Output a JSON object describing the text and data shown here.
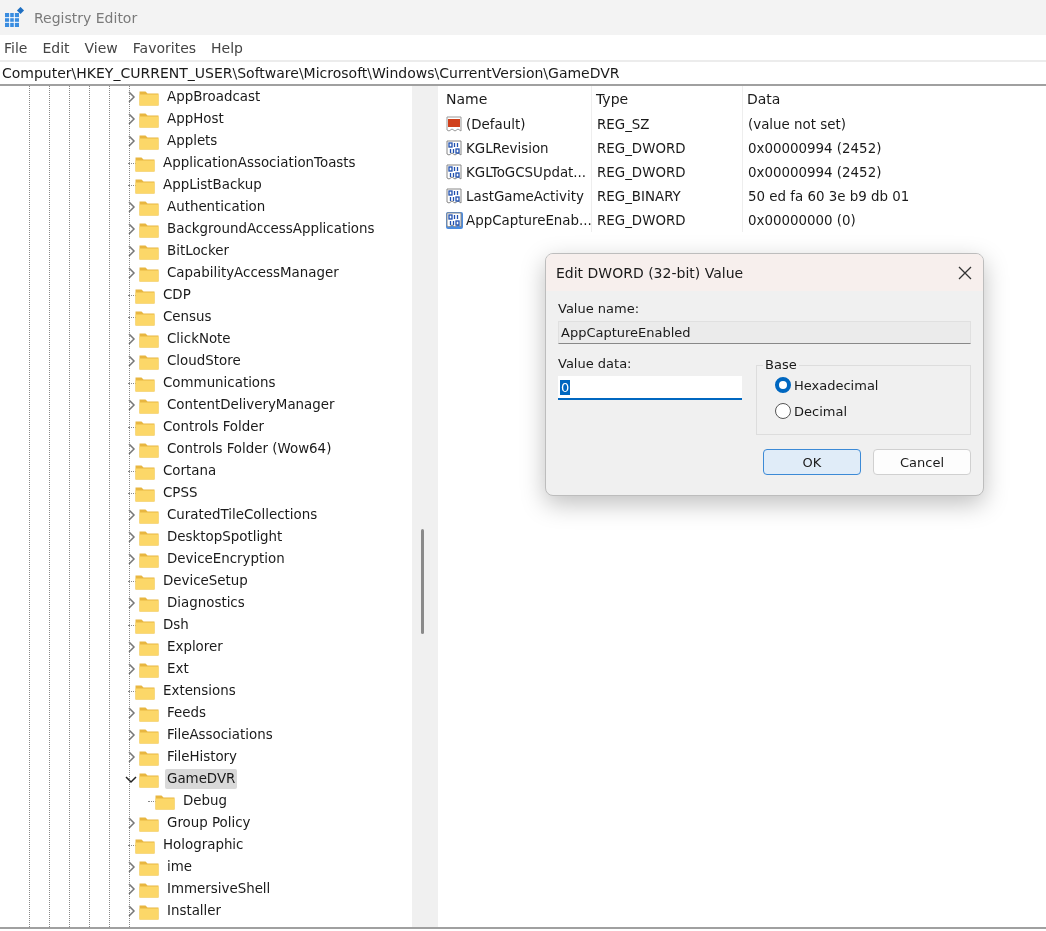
{
  "window": {
    "title": "Registry Editor"
  },
  "menu": [
    "File",
    "Edit",
    "View",
    "Favorites",
    "Help"
  ],
  "address": "Computer\\HKEY_CURRENT_USER\\Software\\Microsoft\\Windows\\CurrentVersion\\GameDVR",
  "tree": [
    {
      "label": "AppBroadcast",
      "expandable": true,
      "expanded": false,
      "selected": false
    },
    {
      "label": "AppHost",
      "expandable": true,
      "expanded": false,
      "selected": false
    },
    {
      "label": "Applets",
      "expandable": true,
      "expanded": false,
      "selected": false
    },
    {
      "label": "ApplicationAssociationToasts",
      "expandable": false,
      "expanded": false,
      "selected": false
    },
    {
      "label": "AppListBackup",
      "expandable": false,
      "expanded": false,
      "selected": false
    },
    {
      "label": "Authentication",
      "expandable": true,
      "expanded": false,
      "selected": false
    },
    {
      "label": "BackgroundAccessApplications",
      "expandable": true,
      "expanded": false,
      "selected": false
    },
    {
      "label": "BitLocker",
      "expandable": true,
      "expanded": false,
      "selected": false
    },
    {
      "label": "CapabilityAccessManager",
      "expandable": true,
      "expanded": false,
      "selected": false
    },
    {
      "label": "CDP",
      "expandable": false,
      "expanded": false,
      "selected": false
    },
    {
      "label": "Census",
      "expandable": false,
      "expanded": false,
      "selected": false
    },
    {
      "label": "ClickNote",
      "expandable": true,
      "expanded": false,
      "selected": false
    },
    {
      "label": "CloudStore",
      "expandable": true,
      "expanded": false,
      "selected": false
    },
    {
      "label": "Communications",
      "expandable": false,
      "expanded": false,
      "selected": false
    },
    {
      "label": "ContentDeliveryManager",
      "expandable": true,
      "expanded": false,
      "selected": false
    },
    {
      "label": "Controls Folder",
      "expandable": false,
      "expanded": false,
      "selected": false
    },
    {
      "label": "Controls Folder (Wow64)",
      "expandable": true,
      "expanded": false,
      "selected": false
    },
    {
      "label": "Cortana",
      "expandable": false,
      "expanded": false,
      "selected": false
    },
    {
      "label": "CPSS",
      "expandable": false,
      "expanded": false,
      "selected": false
    },
    {
      "label": "CuratedTileCollections",
      "expandable": true,
      "expanded": false,
      "selected": false
    },
    {
      "label": "DesktopSpotlight",
      "expandable": true,
      "expanded": false,
      "selected": false
    },
    {
      "label": "DeviceEncryption",
      "expandable": true,
      "expanded": false,
      "selected": false
    },
    {
      "label": "DeviceSetup",
      "expandable": false,
      "expanded": false,
      "selected": false
    },
    {
      "label": "Diagnostics",
      "expandable": true,
      "expanded": false,
      "selected": false
    },
    {
      "label": "Dsh",
      "expandable": false,
      "expanded": false,
      "selected": false
    },
    {
      "label": "Explorer",
      "expandable": true,
      "expanded": false,
      "selected": false
    },
    {
      "label": "Ext",
      "expandable": true,
      "expanded": false,
      "selected": false
    },
    {
      "label": "Extensions",
      "expandable": false,
      "expanded": false,
      "selected": false
    },
    {
      "label": "Feeds",
      "expandable": true,
      "expanded": false,
      "selected": false
    },
    {
      "label": "FileAssociations",
      "expandable": true,
      "expanded": false,
      "selected": false
    },
    {
      "label": "FileHistory",
      "expandable": true,
      "expanded": false,
      "selected": false
    },
    {
      "label": "GameDVR",
      "expandable": true,
      "expanded": true,
      "selected": true,
      "children": [
        {
          "label": "Debug",
          "expandable": false,
          "expanded": false,
          "selected": false
        }
      ]
    },
    {
      "label": "Group Policy",
      "expandable": true,
      "expanded": false,
      "selected": false
    },
    {
      "label": "Holographic",
      "expandable": false,
      "expanded": false,
      "selected": false
    },
    {
      "label": "ime",
      "expandable": true,
      "expanded": false,
      "selected": false
    },
    {
      "label": "ImmersiveShell",
      "expandable": true,
      "expanded": false,
      "selected": false
    },
    {
      "label": "Installer",
      "expandable": true,
      "expanded": false,
      "selected": false
    }
  ],
  "values": {
    "columns": [
      "Name",
      "Type",
      "Data"
    ],
    "rows": [
      {
        "kind": "string",
        "name": "(Default)",
        "type": "REG_SZ",
        "data": "(value not set)",
        "selected": false
      },
      {
        "kind": "binary",
        "name": "KGLRevision",
        "type": "REG_DWORD",
        "data": "0x00000994 (2452)",
        "selected": false
      },
      {
        "kind": "binary",
        "name": "KGLToGCSUpdat...",
        "type": "REG_DWORD",
        "data": "0x00000994 (2452)",
        "selected": false
      },
      {
        "kind": "binary",
        "name": "LastGameActivity",
        "type": "REG_BINARY",
        "data": "50 ed fa 60 3e b9 db 01",
        "selected": false
      },
      {
        "kind": "binary",
        "name": "AppCaptureEnab...",
        "type": "REG_DWORD",
        "data": "0x00000000 (0)",
        "selected": true
      }
    ]
  },
  "dialog": {
    "title": "Edit DWORD (32-bit) Value",
    "name_label": "Value name:",
    "name_value": "AppCaptureEnabled",
    "data_label": "Value data:",
    "data_value": "0",
    "base_label": "Base",
    "radios": [
      {
        "label": "Hexadecimal",
        "selected": true
      },
      {
        "label": "Decimal",
        "selected": false
      }
    ],
    "buttons": [
      {
        "label": "OK",
        "default": true
      },
      {
        "label": "Cancel",
        "default": false
      }
    ]
  }
}
